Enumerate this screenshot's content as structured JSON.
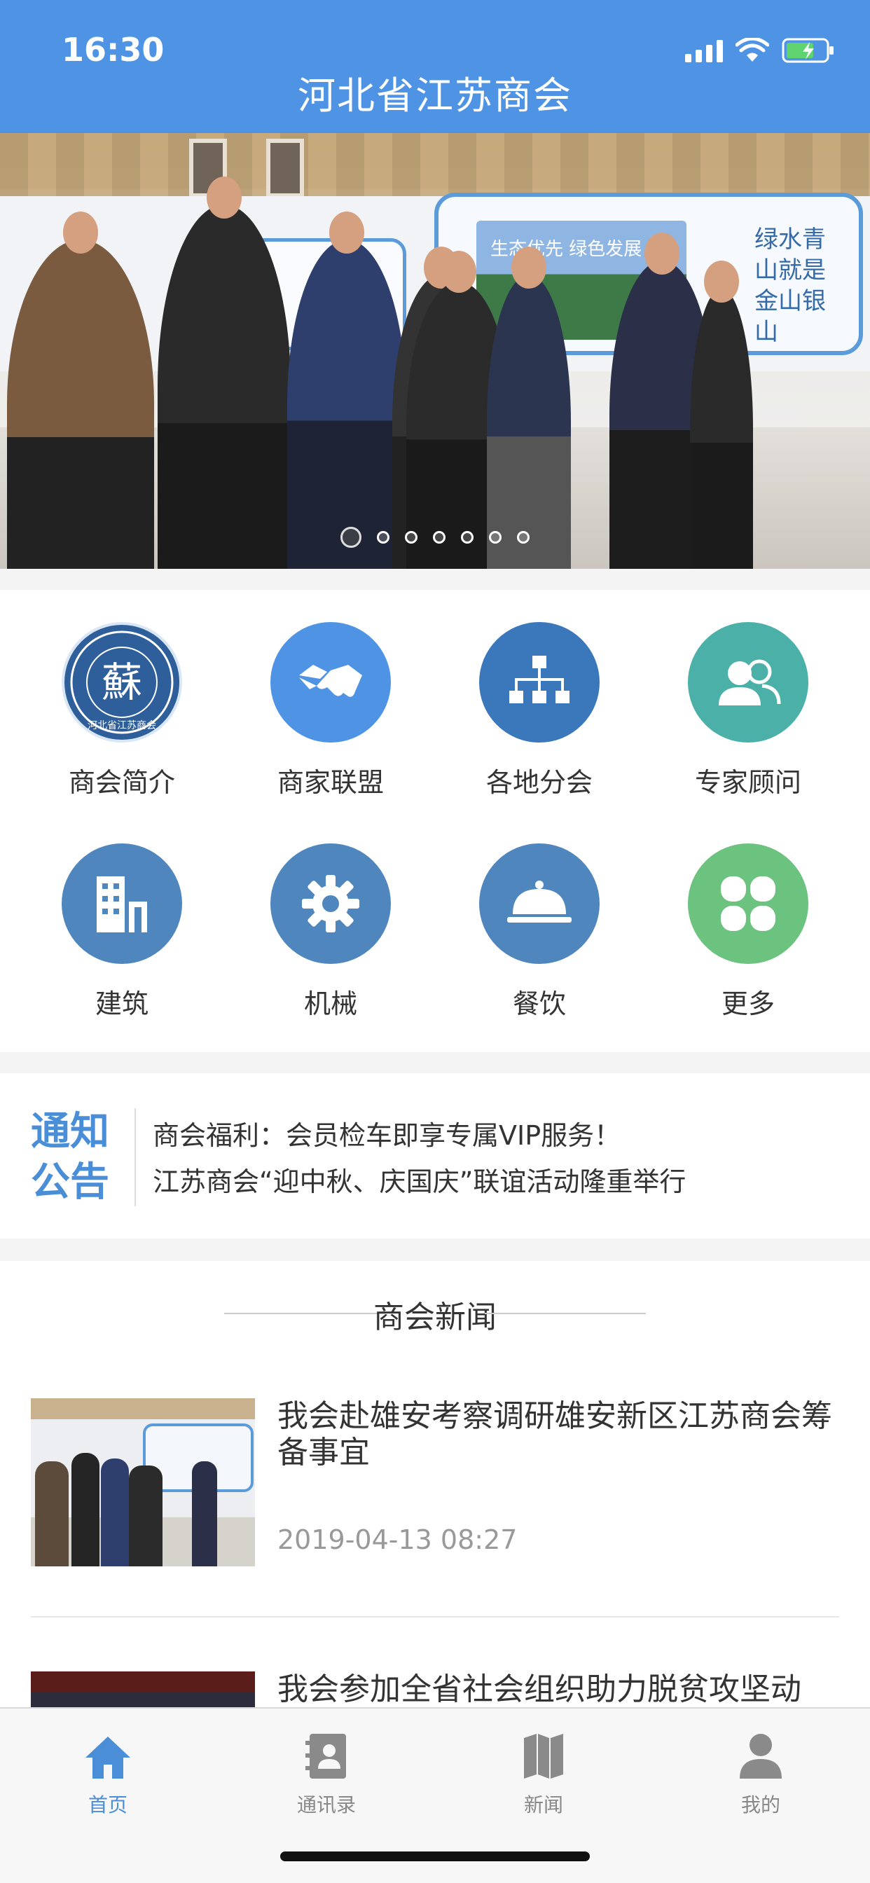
{
  "status_bar": {
    "time": "16:30"
  },
  "header": {
    "title": "河北省江苏商会"
  },
  "banner": {
    "slides_total": 7,
    "active_index": 0,
    "photo_caption": "生态优先 绿色发展",
    "calligraphy": "绿水青山就是金山银山"
  },
  "grid": {
    "items": [
      {
        "label": "商会简介",
        "icon": "chamber-logo-icon",
        "color": "#2f5f9a"
      },
      {
        "label": "商家联盟",
        "icon": "handshake-icon",
        "color": "#4f94e4"
      },
      {
        "label": "各地分会",
        "icon": "org-chart-icon",
        "color": "#3a77bb"
      },
      {
        "label": "专家顾问",
        "icon": "people-icon",
        "color": "#4ab0a8"
      },
      {
        "label": "建筑",
        "icon": "building-icon",
        "color": "#4f86bd"
      },
      {
        "label": "机械",
        "icon": "gear-icon",
        "color": "#4f86bd"
      },
      {
        "label": "餐饮",
        "icon": "food-cloche-icon",
        "color": "#4f86bd"
      },
      {
        "label": "更多",
        "icon": "clover-icon",
        "color": "#6cc27f"
      }
    ],
    "logo_text": "蘇",
    "logo_ring_text": "河北省江苏商会"
  },
  "notice": {
    "tag_line1": "通知",
    "tag_line2": "公告",
    "items": [
      "商会福利：会员检车即享专属VIP服务！",
      "江苏商会“迎中秋、庆国庆”联谊活动隆重举行"
    ]
  },
  "news": {
    "section_title": "商会新闻",
    "items": [
      {
        "title": "我会赴雄安考察调研雄安新区江苏商会筹备事宜",
        "time": "2019-04-13 08:27"
      },
      {
        "title": "我会参加全省社会组织助力脱贫攻坚动",
        "time": ""
      }
    ]
  },
  "tabbar": {
    "tabs": [
      {
        "label": "首页",
        "icon": "home-icon",
        "active": true
      },
      {
        "label": "通讯录",
        "icon": "contacts-icon",
        "active": false
      },
      {
        "label": "新闻",
        "icon": "map-book-icon",
        "active": false
      },
      {
        "label": "我的",
        "icon": "person-icon",
        "active": false
      }
    ]
  },
  "colors": {
    "brand": "#4f94e4",
    "tab_active": "#4a8ed8",
    "tab_inactive": "#888888"
  }
}
